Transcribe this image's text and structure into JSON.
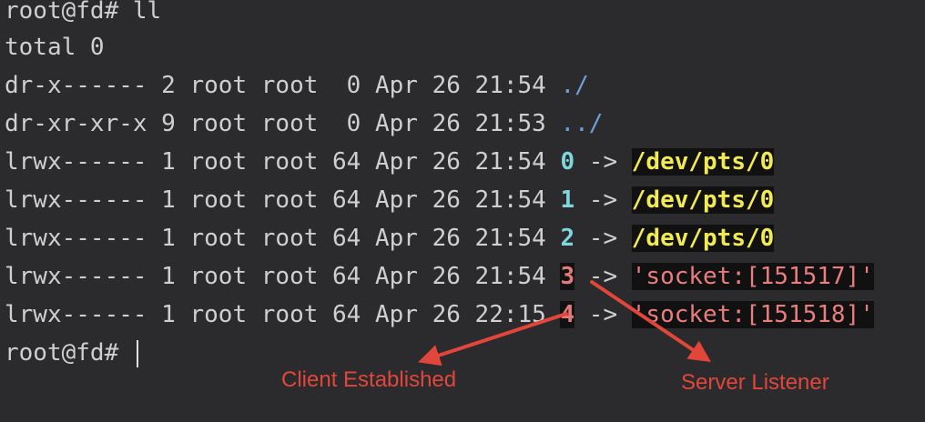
{
  "terminal": {
    "prompt_line_1": "root@fd# ll",
    "total_line": "total 0",
    "entries": [
      {
        "meta": "dr-x------ 2 root root  0 Apr 26 21:54 ",
        "name": "./"
      },
      {
        "meta": "dr-xr-xr-x 9 root root  0 Apr 26 21:53 ",
        "name": "../"
      },
      {
        "meta": "lrwx------ 1 root root 64 Apr 26 21:54 ",
        "fd": "0",
        "arrow": " -> ",
        "target": "/dev/pts/0"
      },
      {
        "meta": "lrwx------ 1 root root 64 Apr 26 21:54 ",
        "fd": "1",
        "arrow": " -> ",
        "target": "/dev/pts/0"
      },
      {
        "meta": "lrwx------ 1 root root 64 Apr 26 21:54 ",
        "fd": "2",
        "arrow": " -> ",
        "target": "/dev/pts/0"
      },
      {
        "meta": "lrwx------ 1 root root 64 Apr 26 21:54 ",
        "fd": "3",
        "arrow": " -> ",
        "target": "'socket:[151517]'"
      },
      {
        "meta": "lrwx------ 1 root root 64 Apr 26 22:15 ",
        "fd": "4",
        "arrow": " -> ",
        "target": "'socket:[151518]'"
      }
    ],
    "prompt_line_2": "root@fd# "
  },
  "annotations": {
    "client": "Client Established",
    "server": "Server Listener"
  },
  "colors": {
    "background": "#2b2b2d",
    "text": "#cfcfcf",
    "directory": "#6f9fd8",
    "fd_cyan": "#7fd6dc",
    "fd_red": "#e27a7a",
    "pts_yellow": "#f2ea52",
    "socket_red": "#ea7d7d",
    "annotation_red": "#e2463a"
  }
}
